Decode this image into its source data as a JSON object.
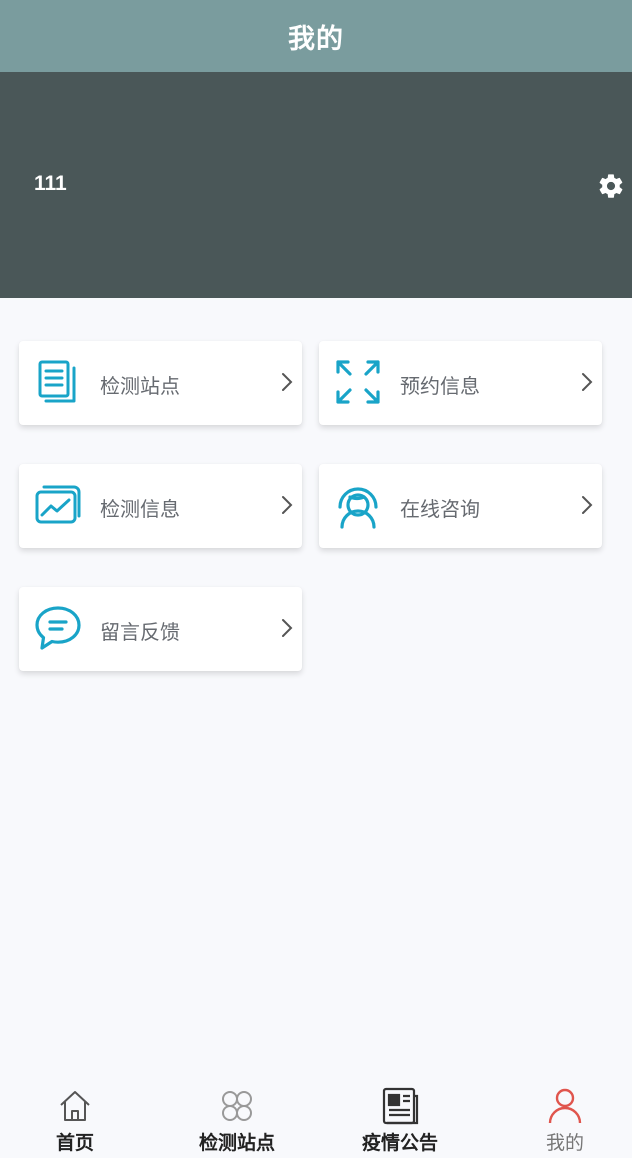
{
  "header": {
    "title": "我的"
  },
  "profile": {
    "username": "111",
    "settings_icon": "gear-icon"
  },
  "menu": {
    "items": [
      {
        "label": "检测站点",
        "icon": "document-stack-icon"
      },
      {
        "label": "预约信息",
        "icon": "expand-arrows-icon"
      },
      {
        "label": "检测信息",
        "icon": "image-chart-icon"
      },
      {
        "label": "在线咨询",
        "icon": "headset-user-icon"
      },
      {
        "label": "留言反馈",
        "icon": "chat-bubble-icon"
      }
    ],
    "icon_color": "#19a4c8",
    "chevron": "›"
  },
  "tabbar": {
    "active_color": "#e0554d",
    "items": [
      {
        "label": "首页",
        "icon": "home-icon"
      },
      {
        "label": "检测站点",
        "icon": "clover-icon"
      },
      {
        "label": "疫情公告",
        "icon": "newspaper-icon"
      },
      {
        "label": "我的",
        "icon": "user-icon",
        "active": true
      }
    ]
  }
}
